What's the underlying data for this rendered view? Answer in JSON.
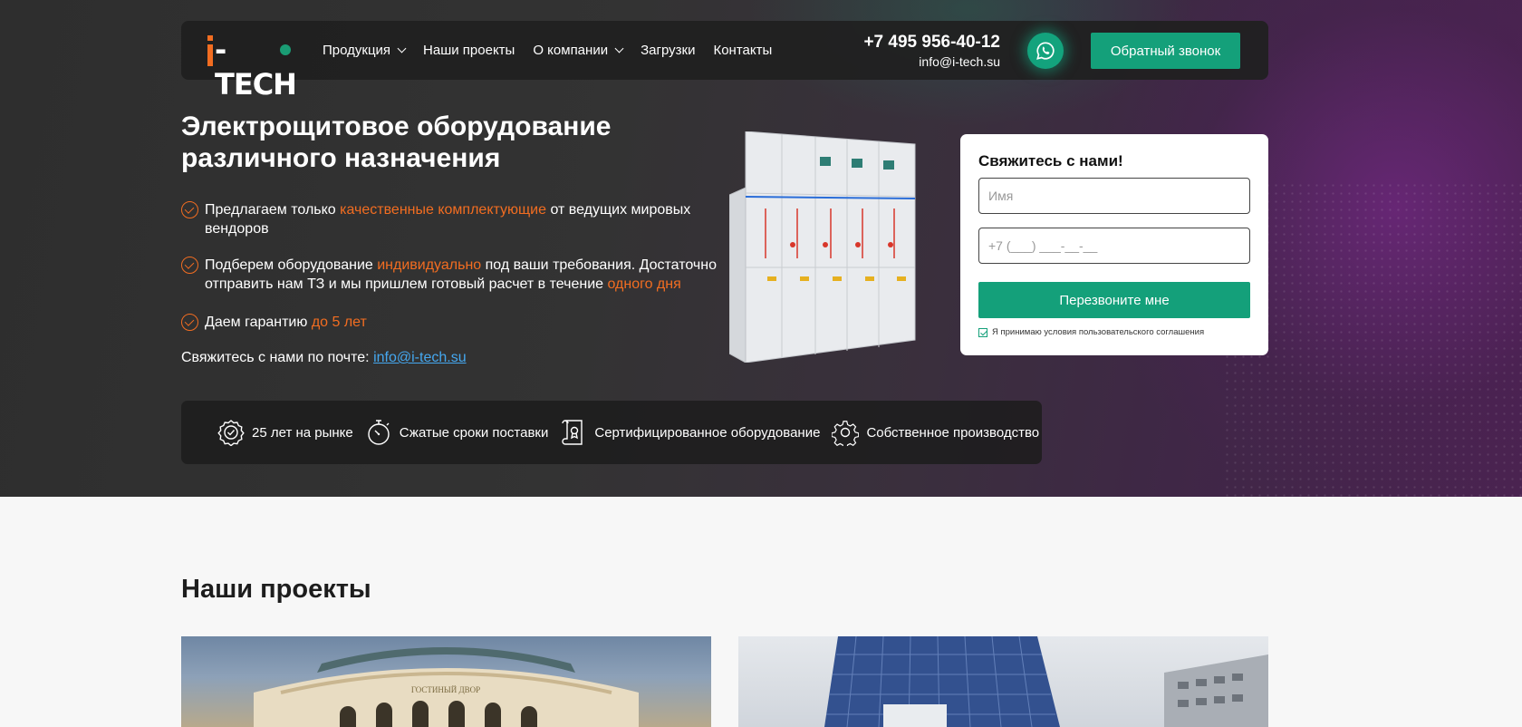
{
  "brand": {
    "logo_text": "I-TECH",
    "accent_color": "#f26d21",
    "green_color": "#14a07a"
  },
  "nav": {
    "items": [
      {
        "label": "Продукция",
        "has_dropdown": true
      },
      {
        "label": "Наши проекты",
        "has_dropdown": false
      },
      {
        "label": "О компании",
        "has_dropdown": true
      },
      {
        "label": "Загрузки",
        "has_dropdown": false
      },
      {
        "label": "Контакты",
        "has_dropdown": false
      }
    ]
  },
  "contacts": {
    "phone": "+7 495 956-40-12",
    "email": "info@i-tech.su"
  },
  "header": {
    "callback_label": "Обратный звонок",
    "whatsapp_icon": "whatsapp-icon"
  },
  "hero": {
    "title_line1": "Электрощитовое оборудование",
    "title_line2": "различного назначения",
    "features": [
      {
        "before": "Предлагаем только ",
        "highlight": "качественные комплектующие",
        "after": " от ведущих мировых вендоров",
        "after2": "",
        "highlight2": ""
      },
      {
        "before": "Подберем оборудование ",
        "highlight": "индивидуально",
        "after": " под ваши требования. Достаточно отправить нам ТЗ и мы пришлем готовый расчет в течение ",
        "highlight2": "одного дня",
        "after2": ""
      },
      {
        "before": "Даем гарантию ",
        "highlight": "до 5 лет",
        "after": "",
        "highlight2": "",
        "after2": ""
      }
    ],
    "mail_prompt": "Свяжитесь с нами по почте:",
    "mail_link": "info@i-tech.su"
  },
  "form": {
    "title": "Свяжитесь с нами!",
    "name_placeholder": "Имя",
    "phone_placeholder": "+7 (___) ___-__-__",
    "submit_label": "Перезвоните мне",
    "agreement": "Я принимаю условия пользовательского соглашения",
    "agreement_checked": true
  },
  "advantages": [
    {
      "icon": "medal-icon",
      "label": "25 лет на рынке"
    },
    {
      "icon": "stopwatch-icon",
      "label": "Сжатые сроки поставки"
    },
    {
      "icon": "certificate-icon",
      "label": "Сертифицированное оборудование"
    },
    {
      "icon": "gear-icon",
      "label": "Собственное производство"
    }
  ],
  "projects": {
    "title": "Наши проекты",
    "cards": [
      {
        "image": "gostiny-dvor-photo",
        "sign_text": "ГОСТИНЫЙ ДВОР"
      },
      {
        "image": "glass-tower-photo"
      }
    ]
  }
}
